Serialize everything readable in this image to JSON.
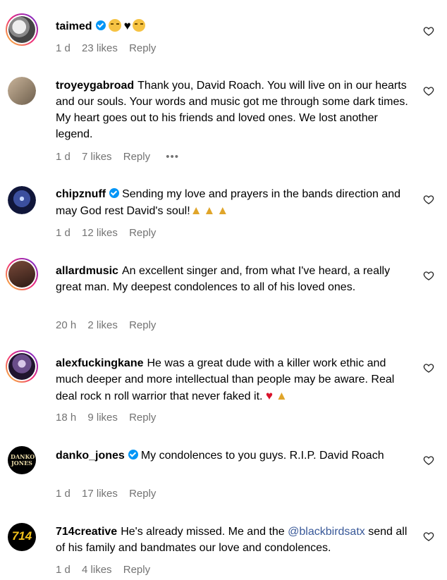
{
  "comments": [
    {
      "username": "taimed",
      "verified": true,
      "text": "",
      "time": "1 d",
      "likes": "23 likes",
      "reply": "Reply"
    },
    {
      "username": "troyeygabroad",
      "verified": false,
      "text": "Thank you, David Roach. You will live on in our hearts and our souls. Your words and music got me through some dark times. My heart goes out to his friends and loved ones. We lost another legend.",
      "time": "1 d",
      "likes": "7 likes",
      "reply": "Reply",
      "more": "•••"
    },
    {
      "username": "chipznuff",
      "verified": true,
      "text": "Sending my love and prayers in the bands direction and may God rest David's soul!",
      "time": "1 d",
      "likes": "12 likes",
      "reply": "Reply"
    },
    {
      "username": "allardmusic",
      "verified": false,
      "text": "An excellent singer and, from what I've heard, a really great man. My deepest condolences to all of his loved ones.",
      "time": "20 h",
      "likes": "2 likes",
      "reply": "Reply"
    },
    {
      "username": "alexfuckingkane",
      "verified": false,
      "text": "He was a great dude with a killer work ethic and much deeper and more intellectual than people may be aware. Real deal rock n roll warrior that never faked it.",
      "time": "18 h",
      "likes": "9 likes",
      "reply": "Reply"
    },
    {
      "username": "danko_jones",
      "verified": true,
      "text": "My condolences to you guys. R.I.P. David Roach",
      "time": "1 d",
      "likes": "17 likes",
      "reply": "Reply",
      "avatar_text": "DANKO JONES"
    },
    {
      "username": "714creative",
      "verified": false,
      "text_before": "He's already missed. Me and the",
      "mention": "@blackbirdsatx",
      "text_after": "send all of his family and bandmates our love and condolences.",
      "time": "1 d",
      "likes": "4 likes",
      "reply": "Reply",
      "avatar_text": "714"
    }
  ],
  "colors": {
    "meta": "#737373",
    "mention": "#385898",
    "verified": "#0095f6"
  },
  "icons": {
    "like": "heart-outline-icon",
    "verified": "verified-badge-icon"
  }
}
